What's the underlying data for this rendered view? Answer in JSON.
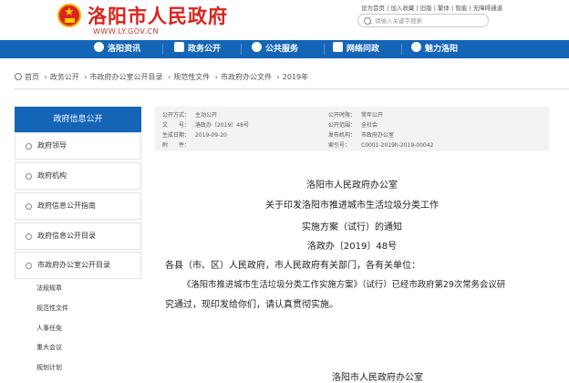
{
  "header": {
    "site_title": "洛阳市人民政府",
    "site_url": "WWW.LY.GOV.CN",
    "top_links": [
      "设为首页",
      "加入收藏",
      "旧版",
      "繁体",
      "智能",
      "无障碍通道"
    ],
    "search_placeholder": "请输入关键字搜索"
  },
  "nav": {
    "items": [
      {
        "label": "洛阳资讯",
        "icon": "home-icon"
      },
      {
        "label": "政务公开",
        "icon": "document-icon"
      },
      {
        "label": "公共服务",
        "icon": "people-icon"
      },
      {
        "label": "网络问政",
        "icon": "monitor-icon"
      },
      {
        "label": "魅力洛阳",
        "icon": "landmark-icon"
      }
    ]
  },
  "breadcrumb": [
    "首页",
    "政务公开",
    "市政府办公室公开目录",
    "规范性文件",
    "市政府办公文件",
    "2019年"
  ],
  "sidebar": {
    "header": "政府信息公开",
    "items": [
      "政府领导",
      "政府机构",
      "政府信息公开指南",
      "政府信息公开目录",
      "市政府办公室公开目录"
    ],
    "subitems": [
      "法规规章",
      "规范性文件",
      "人事任免",
      "重大会议",
      "规划计划"
    ]
  },
  "meta": {
    "left": [
      {
        "label": "公开方式：",
        "value": "主动公开"
      },
      {
        "label": "文　　号：",
        "value": "洛政办〔2019〕48号"
      },
      {
        "label": "生成日期：",
        "value": "2019-09-20"
      },
      {
        "label": "附　　件：",
        "value": ""
      }
    ],
    "right": [
      {
        "label": "公开时限：",
        "value": "常年公开"
      },
      {
        "label": "公开范围：",
        "value": "全社会"
      },
      {
        "label": "发布机构：",
        "value": "市政府办公室"
      },
      {
        "label": "索引号：",
        "value": "C0001-2019h-2019-00042"
      }
    ]
  },
  "document": {
    "issuer": "洛阳市人民政府办公室",
    "title_line1": "关于印发洛阳市推进城市生活垃圾分类工作",
    "title_line2": "实施方案（试行）的通知",
    "doc_number": "洛政办〔2019〕48号",
    "recipients": "各县（市、区）人民政府，市人民政府有关部门，各有关单位：",
    "body_line1": "《洛阳市推进城市生活垃圾分类工作实施方案》（试行）已经市政府第29次常务会议研",
    "body_line2": "究通过，现印发给你们，请认真贯彻实施。",
    "signature": "洛阳市人民政府办公室"
  },
  "colors": {
    "accent": "#1565b7",
    "brand_red": "#d8241c"
  }
}
